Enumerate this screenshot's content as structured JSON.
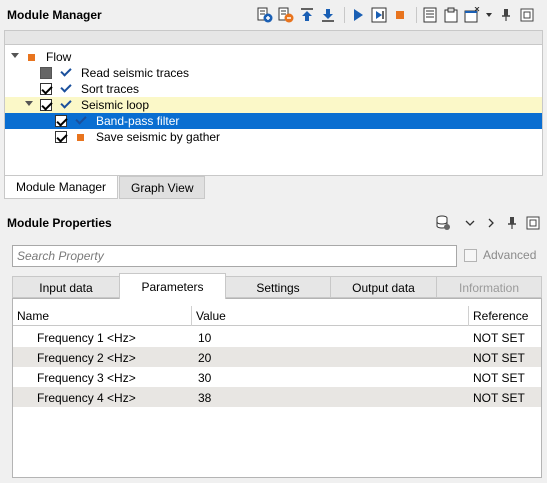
{
  "module_manager": {
    "title": "Module Manager",
    "toolbar_icons": [
      "add-module-icon",
      "remove-module-icon",
      "move-up-icon",
      "move-down-icon",
      "run-icon",
      "run-step-icon",
      "stop-icon",
      "list-icon",
      "clipboard-icon",
      "window-options-icon",
      "pin-icon",
      "float-icon"
    ]
  },
  "tree": {
    "items": [
      {
        "label": "Flow"
      },
      {
        "label": "Read seismic traces"
      },
      {
        "label": "Sort traces"
      },
      {
        "label": "Seismic loop"
      },
      {
        "label": "Band-pass filter"
      },
      {
        "label": "Save seismic by gather"
      }
    ]
  },
  "bottom_tabs": [
    {
      "label": "Module Manager",
      "active": true
    },
    {
      "label": "Graph View",
      "active": false
    }
  ],
  "module_properties": {
    "title": "Module Properties",
    "search_placeholder": "Search Property",
    "advanced_label": "Advanced"
  },
  "property_tabs": [
    {
      "label": "Input data"
    },
    {
      "label": "Parameters"
    },
    {
      "label": "Settings"
    },
    {
      "label": "Output data"
    },
    {
      "label": "Information"
    }
  ],
  "grid": {
    "columns": [
      "Name",
      "Value",
      "Reference"
    ],
    "rows": [
      {
        "name": "Frequency 1 <Hz>",
        "value": "10",
        "reference": "NOT SET"
      },
      {
        "name": "Frequency 2 <Hz>",
        "value": "20",
        "reference": "NOT SET"
      },
      {
        "name": "Frequency 3 <Hz>",
        "value": "30",
        "reference": "NOT SET"
      },
      {
        "name": "Frequency 4 <Hz>",
        "value": "38",
        "reference": "NOT SET"
      }
    ]
  },
  "colors": {
    "selection": "#0a6ed1",
    "highlight_row": "#fbf8c8",
    "module_marker": "#e8741e",
    "accent_blue": "#1a5fb4"
  }
}
